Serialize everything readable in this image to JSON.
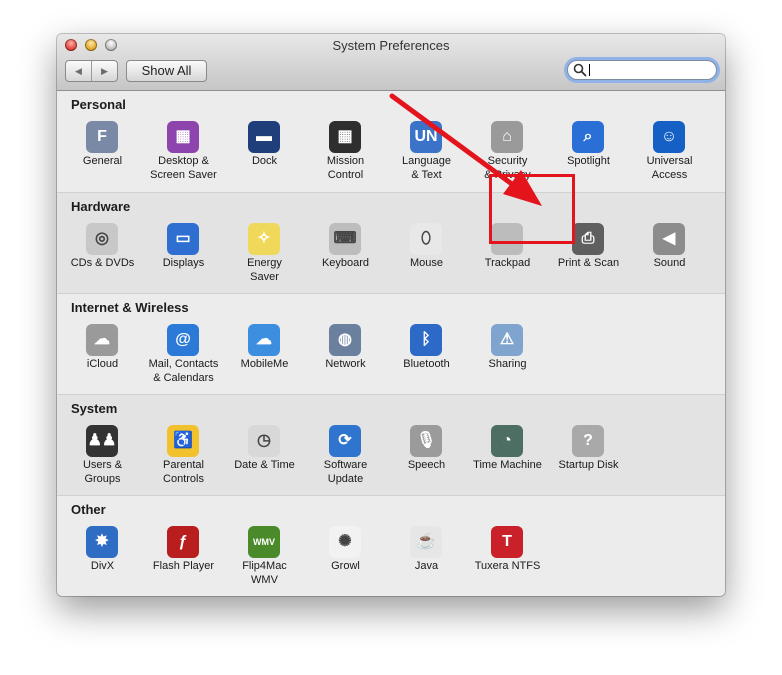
{
  "window": {
    "title": "System Preferences",
    "nav_back": "◀",
    "nav_forward": "▶",
    "show_all_label": "Show All",
    "search_value": "",
    "search_placeholder": ""
  },
  "sections": [
    {
      "title": "Personal",
      "items": [
        {
          "label": "General",
          "icon": "general-icon",
          "color": "#7a8aa6",
          "glyph": "F"
        },
        {
          "label": "Desktop &\nScreen Saver",
          "icon": "desktop-screensaver-icon",
          "color": "#8e44ad",
          "glyph": "▦"
        },
        {
          "label": "Dock",
          "icon": "dock-icon",
          "color": "#1f3f7a",
          "glyph": "▬"
        },
        {
          "label": "Mission\nControl",
          "icon": "mission-control-icon",
          "color": "#2e2e2e",
          "glyph": "▦"
        },
        {
          "label": "Language\n& Text",
          "icon": "language-text-icon",
          "color": "#3b73c9",
          "glyph": "UN"
        },
        {
          "label": "Security\n& Privacy",
          "icon": "security-privacy-icon",
          "color": "#9a9a9a",
          "glyph": "⌂"
        },
        {
          "label": "Spotlight",
          "icon": "spotlight-icon",
          "color": "#2a6fd6",
          "glyph": "⌕"
        },
        {
          "label": "Universal\nAccess",
          "icon": "universal-access-icon",
          "color": "#1560c5",
          "glyph": "☺"
        }
      ]
    },
    {
      "title": "Hardware",
      "items": [
        {
          "label": "CDs & DVDs",
          "icon": "cds-dvds-icon",
          "color": "#c8c8c8",
          "glyph": "◎"
        },
        {
          "label": "Displays",
          "icon": "displays-icon",
          "color": "#2f6fd1",
          "glyph": "▭"
        },
        {
          "label": "Energy\nSaver",
          "icon": "energy-saver-icon",
          "color": "#f0d95a",
          "glyph": "✧"
        },
        {
          "label": "Keyboard",
          "icon": "keyboard-icon",
          "color": "#bdbdbd",
          "glyph": "⌨"
        },
        {
          "label": "Mouse",
          "icon": "mouse-icon",
          "color": "#e8e8e8",
          "glyph": "⬯"
        },
        {
          "label": "Trackpad",
          "icon": "trackpad-icon",
          "color": "#bcbcbc",
          "glyph": ""
        },
        {
          "label": "Print & Scan",
          "icon": "printer-icon",
          "color": "#5f5f5f",
          "glyph": "⎙"
        },
        {
          "label": "Sound",
          "icon": "speaker-icon",
          "color": "#8c8c8c",
          "glyph": "◀"
        }
      ]
    },
    {
      "title": "Internet & Wireless",
      "items": [
        {
          "label": "iCloud",
          "icon": "icloud-icon",
          "color": "#9a9a9a",
          "glyph": "☁"
        },
        {
          "label": "Mail, Contacts\n& Calendars",
          "icon": "mail-contacts-calendars-icon",
          "color": "#2b7ad8",
          "glyph": "@"
        },
        {
          "label": "MobileMe",
          "icon": "mobileme-icon",
          "color": "#3c8ede",
          "glyph": "☁"
        },
        {
          "label": "Network",
          "icon": "network-icon",
          "color": "#6b7f9e",
          "glyph": "◍"
        },
        {
          "label": "Bluetooth",
          "icon": "bluetooth-icon",
          "color": "#2d6ac7",
          "glyph": "ᛒ"
        },
        {
          "label": "Sharing",
          "icon": "sharing-icon",
          "color": "#7fa5cf",
          "glyph": "⚠"
        }
      ]
    },
    {
      "title": "System",
      "items": [
        {
          "label": "Users &\nGroups",
          "icon": "users-groups-icon",
          "color": "#333333",
          "glyph": "♟♟"
        },
        {
          "label": "Parental\nControls",
          "icon": "parental-controls-icon",
          "color": "#f2c12e",
          "glyph": "♿"
        },
        {
          "label": "Date & Time",
          "icon": "date-time-icon",
          "color": "#d8d8d8",
          "glyph": "◷"
        },
        {
          "label": "Software\nUpdate",
          "icon": "software-update-icon",
          "color": "#2f74cf",
          "glyph": "⟳"
        },
        {
          "label": "Speech",
          "icon": "microphone-icon",
          "color": "#9b9b9b",
          "glyph": "🎙"
        },
        {
          "label": "Time Machine",
          "icon": "time-machine-icon",
          "color": "#4d6e62",
          "glyph": "◔"
        },
        {
          "label": "Startup Disk",
          "icon": "startup-disk-icon",
          "color": "#a9a9a9",
          "glyph": "?"
        }
      ]
    },
    {
      "title": "Other",
      "items": [
        {
          "label": "DivX",
          "icon": "divx-icon",
          "color": "#2f6dc4",
          "glyph": "✸"
        },
        {
          "label": "Flash Player",
          "icon": "flash-player-icon",
          "color": "#b81e1e",
          "glyph": "ƒ"
        },
        {
          "label": "Flip4Mac\nWMV",
          "icon": "flip4mac-icon",
          "color": "#4a8a2a",
          "glyph": "WMV"
        },
        {
          "label": "Growl",
          "icon": "growl-icon",
          "color": "#f2f2f2",
          "glyph": "✺"
        },
        {
          "label": "Java",
          "icon": "java-icon",
          "color": "#e6e6e6",
          "glyph": "☕"
        },
        {
          "label": "Tuxera NTFS",
          "icon": "tuxera-ntfs-icon",
          "color": "#c9202a",
          "glyph": "T"
        }
      ]
    }
  ],
  "annotation": {
    "highlight_color": "#e4141d",
    "highlighted_item": "Print & Scan"
  }
}
